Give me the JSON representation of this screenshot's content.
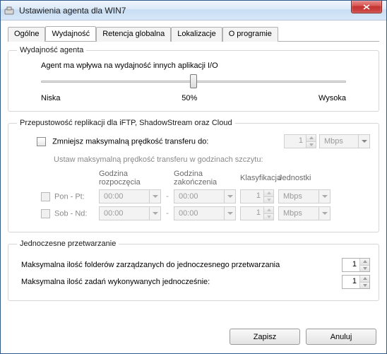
{
  "window": {
    "title": "Ustawienia agenta dla WIN7"
  },
  "tabs": {
    "general": "Ogólne",
    "performance": "Wydajność",
    "retention": "Retencja globalna",
    "locations": "Lokalizacje",
    "about": "O programie"
  },
  "performance": {
    "legend": "Wydajność agenta",
    "description": "Agent ma wpływa na wydajność innych aplikacji I/O",
    "low": "Niska",
    "percent": "50%",
    "high": "Wysoka"
  },
  "bandwidth": {
    "legend": "Przepustowość replikacji dla iFTP, ShadowStream oraz Cloud",
    "reduce_label": "Zmniejsz maksymalną prędkość transferu do:",
    "reduce_value": "1",
    "reduce_unit": "Mbps",
    "schedule_label": "Ustaw maksymalną prędkość transferu w godzinach szczytu:",
    "headers": {
      "start": "Godzina rozpoczęcia",
      "end": "Godzina zakończenia",
      "class": "Klasyfikacja",
      "unit": "Jednostki"
    },
    "rows": [
      {
        "day": "Pon - Pt:",
        "start": "00:00",
        "end": "00:00",
        "class": "1",
        "unit": "Mbps"
      },
      {
        "day": "Sob - Nd:",
        "start": "00:00",
        "end": "00:00",
        "class": "1",
        "unit": "Mbps"
      }
    ]
  },
  "concurrent": {
    "legend": "Jednoczesne przetwarzanie",
    "folders_label": "Maksymalna ilość folderów zarządzanych do jednoczesnego przetwarzania",
    "folders_value": "1",
    "tasks_label": "Maksymalna ilość zadań wykonywanych jednocześnie:",
    "tasks_value": "1"
  },
  "buttons": {
    "save": "Zapisz",
    "cancel": "Anuluj"
  }
}
